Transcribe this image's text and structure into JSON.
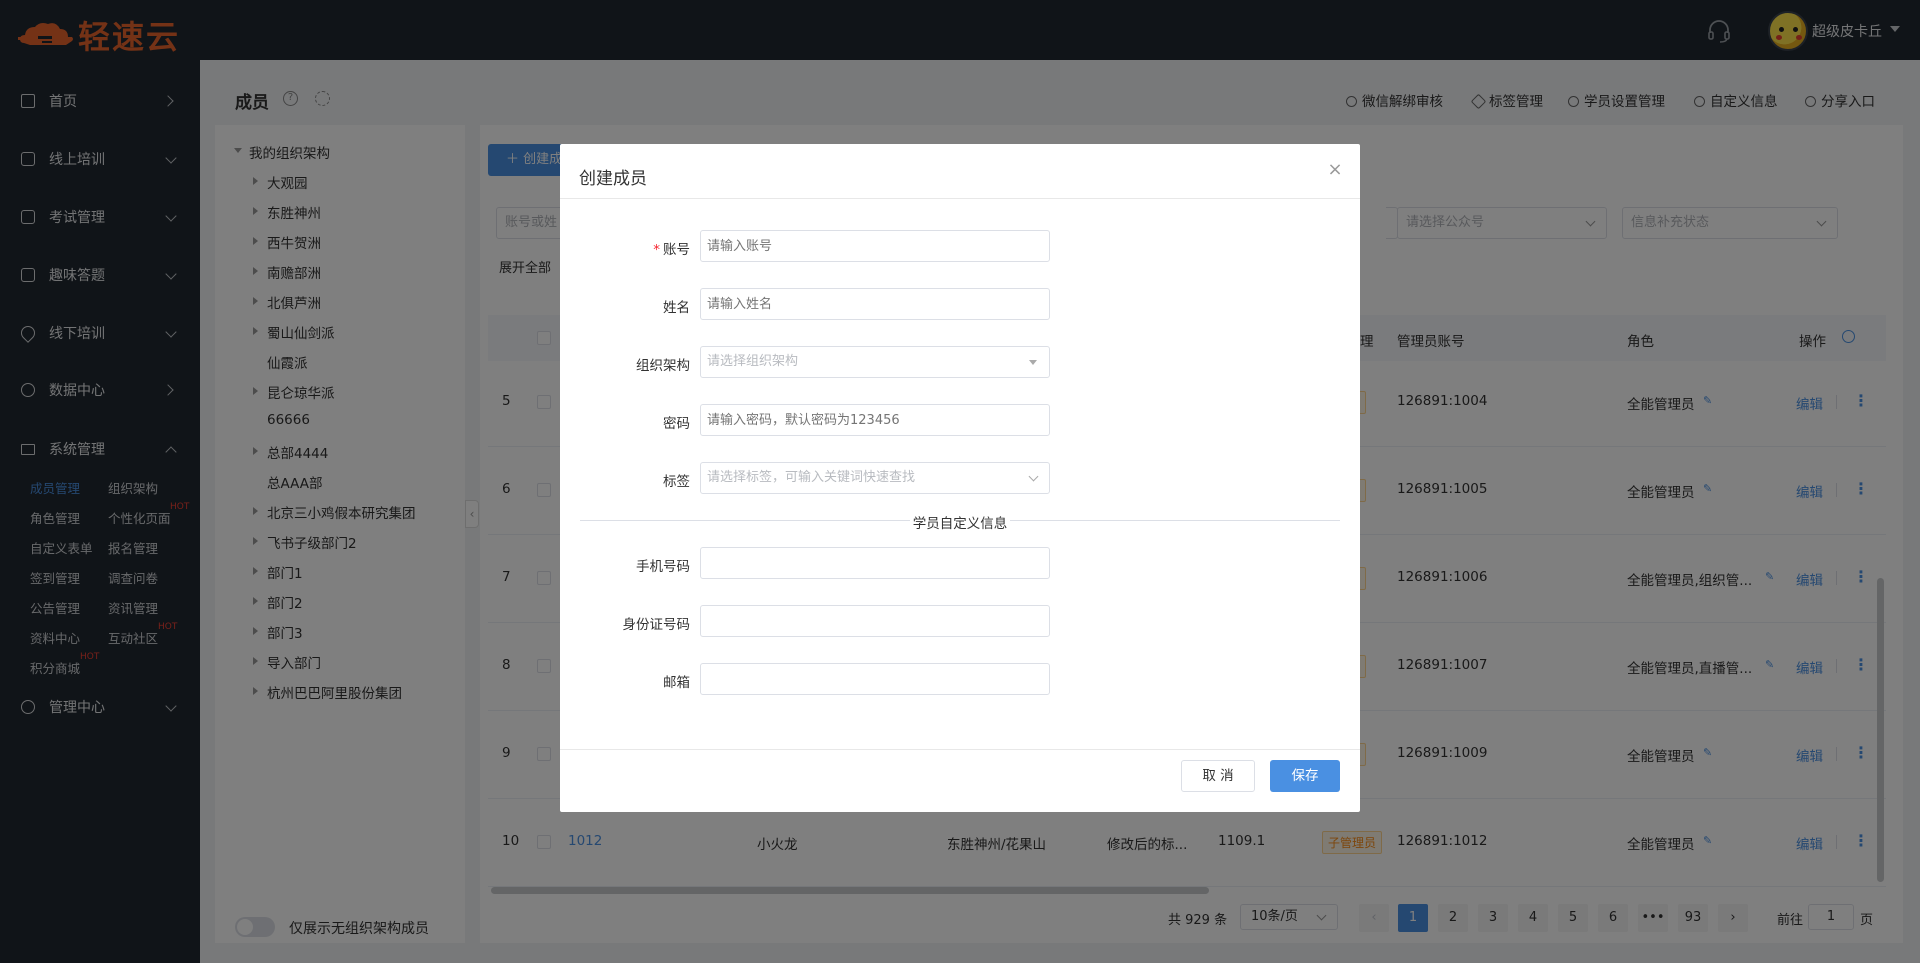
{
  "app": {
    "logo_text": "轻速云",
    "user_name": "超级皮卡丘"
  },
  "sidebar": {
    "items": [
      {
        "label": "首页",
        "icon": "home-icon"
      },
      {
        "label": "线上培训",
        "icon": "monitor-icon"
      },
      {
        "label": "考试管理",
        "icon": "exam-icon"
      },
      {
        "label": "趣味答题",
        "icon": "quiz-icon"
      },
      {
        "label": "线下培训",
        "icon": "location-icon"
      },
      {
        "label": "数据中心",
        "icon": "data-icon"
      },
      {
        "label": "系统管理",
        "icon": "system-icon"
      },
      {
        "label": "管理中心",
        "icon": "manage-icon"
      }
    ],
    "sub_items": [
      {
        "label": "成员管理",
        "active": true
      },
      {
        "label": "组织架构"
      },
      {
        "label": "角色管理"
      },
      {
        "label": "个性化页面",
        "hot": "HOT"
      },
      {
        "label": "自定义表单"
      },
      {
        "label": "报名管理"
      },
      {
        "label": "签到管理"
      },
      {
        "label": "调查问卷"
      },
      {
        "label": "公告管理"
      },
      {
        "label": "资讯管理"
      },
      {
        "label": "资料中心"
      },
      {
        "label": "互动社区",
        "hot": "HOT"
      },
      {
        "label": "积分商城",
        "hot": "HOT"
      }
    ]
  },
  "header": {
    "title": "成员",
    "links": [
      "微信解绑审核",
      "标签管理",
      "学员设置管理",
      "自定义信息",
      "分享入口"
    ]
  },
  "tree": {
    "root": "我的组织架构",
    "items": [
      "大观园",
      "东胜神州",
      "西牛贺洲",
      "南赡部洲",
      "北俱芦洲",
      "蜀山仙剑派",
      "仙霞派",
      "昆仑琼华派",
      "66666",
      "总部4444",
      "总AAA部",
      "北京三小鸡假本研究集团",
      "飞书子级部门2",
      "部门1",
      "部门2",
      "部门3",
      "导入部门",
      "杭州巴巴阿里股份集团"
    ],
    "toggle_label": "仅展示无组织架构成员"
  },
  "toolbar": {
    "create_label": "创建成",
    "search_placeholder": "账号或姓",
    "official_placeholder": "请选择公众号",
    "info_status_placeholder": "信息补充状态",
    "expand_all": "展开全部"
  },
  "table": {
    "headers": {
      "admin": "理",
      "admin_account": "管理员账号",
      "role": "角色",
      "ops": "操作"
    },
    "rows": [
      {
        "idx": "5",
        "tag": "员",
        "admin_account": "126891:1004",
        "role": "全能管理员"
      },
      {
        "idx": "6",
        "tag": "员",
        "admin_account": "126891:1005",
        "role": "全能管理员"
      },
      {
        "idx": "7",
        "tag": "员",
        "admin_account": "126891:1006",
        "role": "全能管理员,组织管..."
      },
      {
        "idx": "8",
        "tag": "员",
        "admin_account": "126891:1007",
        "role": "全能管理员,直播管..."
      },
      {
        "idx": "9",
        "tag": "员",
        "admin_account": "126891:1009",
        "role": "全能管理员"
      },
      {
        "idx": "10",
        "account": "1012",
        "name": "小火龙",
        "org": "东胜神州/花果山",
        "label": "修改后的标...",
        "score": "1109.1",
        "tag": "子管理员",
        "admin_account": "126891:1012",
        "role": "全能管理员"
      }
    ],
    "edit_label": "编辑"
  },
  "pagination": {
    "total": "共 929 条",
    "page_size": "10条/页",
    "pages": [
      "1",
      "2",
      "3",
      "4",
      "5",
      "6",
      "•••",
      "93"
    ],
    "current": "1",
    "goto_label": "前往",
    "goto_value": "1",
    "unit": "页"
  },
  "modal": {
    "title": "创建成员",
    "fields": [
      {
        "label": "账号",
        "required": true,
        "placeholder": "请输入账号"
      },
      {
        "label": "姓名",
        "placeholder": "请输入姓名"
      },
      {
        "label": "组织架构",
        "placeholder": "请选择组织架构"
      },
      {
        "label": "密码",
        "placeholder": "请输入密码，默认密码为123456"
      },
      {
        "label": "标签",
        "placeholder": "请选择标签，可输入关键词快速查找"
      }
    ],
    "divider": "学员自定义信息",
    "custom_fields": [
      {
        "label": "手机号码"
      },
      {
        "label": "身份证号码"
      },
      {
        "label": "邮箱"
      }
    ],
    "cancel_label": "取 消",
    "save_label": "保存"
  },
  "colors": {
    "primary": "#4a90e2",
    "brand": "#e8642c",
    "sidebar_bg": "#212830",
    "sub_tag": "#fa8c16"
  }
}
